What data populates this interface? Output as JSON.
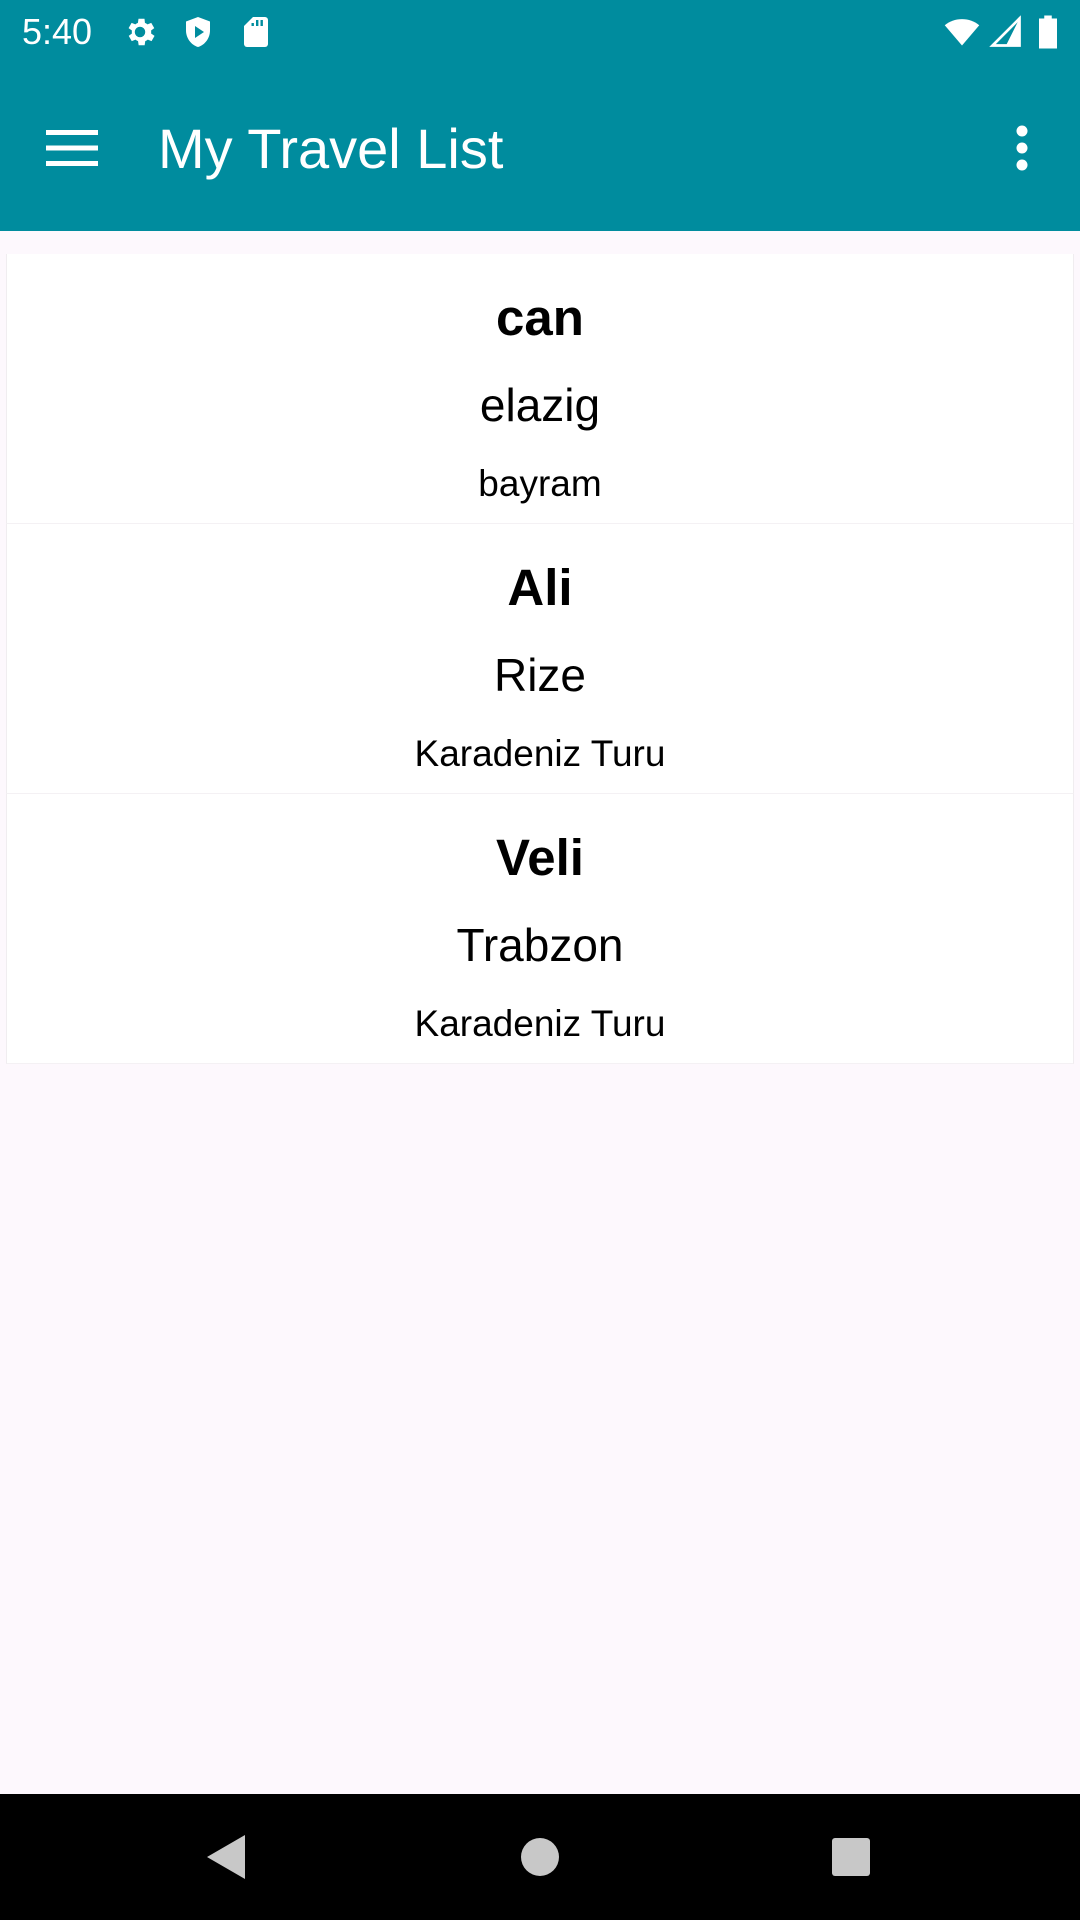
{
  "status_bar": {
    "time": "5:40",
    "icons_left": [
      "gear-icon",
      "shield-icon",
      "sd-card-icon"
    ],
    "icons_right": [
      "wifi-icon",
      "cellular-signal-icon",
      "battery-icon"
    ]
  },
  "app_bar": {
    "title": "My Travel List",
    "menu_icon": "hamburger-menu-icon",
    "overflow_icon": "more-vert-icon"
  },
  "travel_list": [
    {
      "name": "can",
      "city": "elazig",
      "trip": "bayram"
    },
    {
      "name": "Ali",
      "city": "Rize",
      "trip": "Karadeniz Turu"
    },
    {
      "name": "Veli",
      "city": "Trabzon",
      "trip": "Karadeniz Turu"
    }
  ],
  "nav_bar": {
    "buttons": [
      "back-icon",
      "home-icon",
      "recents-icon"
    ]
  },
  "colors": {
    "primary": "#008c9e",
    "background": "#fdf8fd",
    "card": "#ffffff",
    "nav_bar": "#000000"
  }
}
